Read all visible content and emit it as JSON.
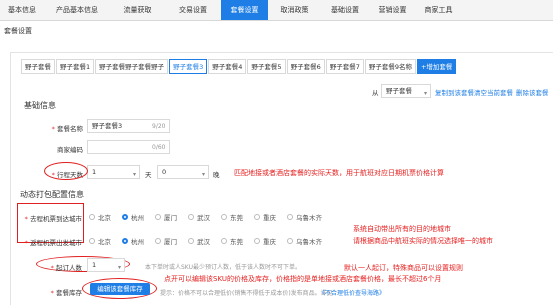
{
  "topnav": [
    "基本信息",
    "产品基本信息",
    "流量获取",
    "交易设置",
    "套餐设置",
    "取消政策",
    "基础设置",
    "营销设置",
    "商家工具"
  ],
  "sub_title": "套餐设置",
  "pkg_tabs": [
    "野子套餐",
    "野子套餐1",
    "野子套餐野子套餐野子",
    "野子套餐3",
    "野子套餐4",
    "野子套餐5",
    "野子套餐6",
    "野子套餐7",
    "野子套餐9名称",
    "+增加套餐"
  ],
  "from": {
    "label": "从",
    "value": "野子套餐",
    "copy": "复制到该套餐",
    "clear": "清空当前套餐",
    "delete": "删除该套餐"
  },
  "basic": {
    "heading": "基础信息",
    "name_label": "套餐名称",
    "name_value": "野子套餐3",
    "name_count": "9/20",
    "code_label": "商家编码",
    "code_count": "0/60",
    "days_label": "行程天数",
    "days_value": "1",
    "days_unit": "天",
    "nights_value": "0",
    "nights_unit": "晚"
  },
  "annotations": {
    "days_note": "匹配地接或者酒店套餐的实际天数，用于航班对应日期机票价格计算",
    "city_note_1": "系统自动带出所有的目的地城市",
    "city_note_2": "请根据商品中航班实际的情况选择唯一的城市",
    "people_note": "默认一人起订，特殊商品可以设置规则",
    "stock_note_1": "点开可以编辑该SKU的价格及库存，价格指的是单地接或酒店套餐价格，最长不超过6个月"
  },
  "dynamic": {
    "heading": "动态打包配置信息",
    "depart_label": "去程机票到达城市",
    "return_label": "返程机票出发城市",
    "cities": [
      "北京",
      "杭州",
      "厦门",
      "武汉",
      "东莞",
      "重庆",
      "乌鲁木齐"
    ],
    "depart_selected": "杭州",
    "return_selected": "杭州"
  },
  "people": {
    "label": "起订人数",
    "value": "1",
    "hint": "本下单时或人SKU最少预订人数，低于该人数时不可下单。"
  },
  "stock": {
    "label": "套餐库存",
    "button": "编辑该套餐库存",
    "hint": "提示：价格不可以合理低价(销售不得低于成本价)发布商品。详见",
    "hint_link": "《不合理低价查导海路》"
  }
}
